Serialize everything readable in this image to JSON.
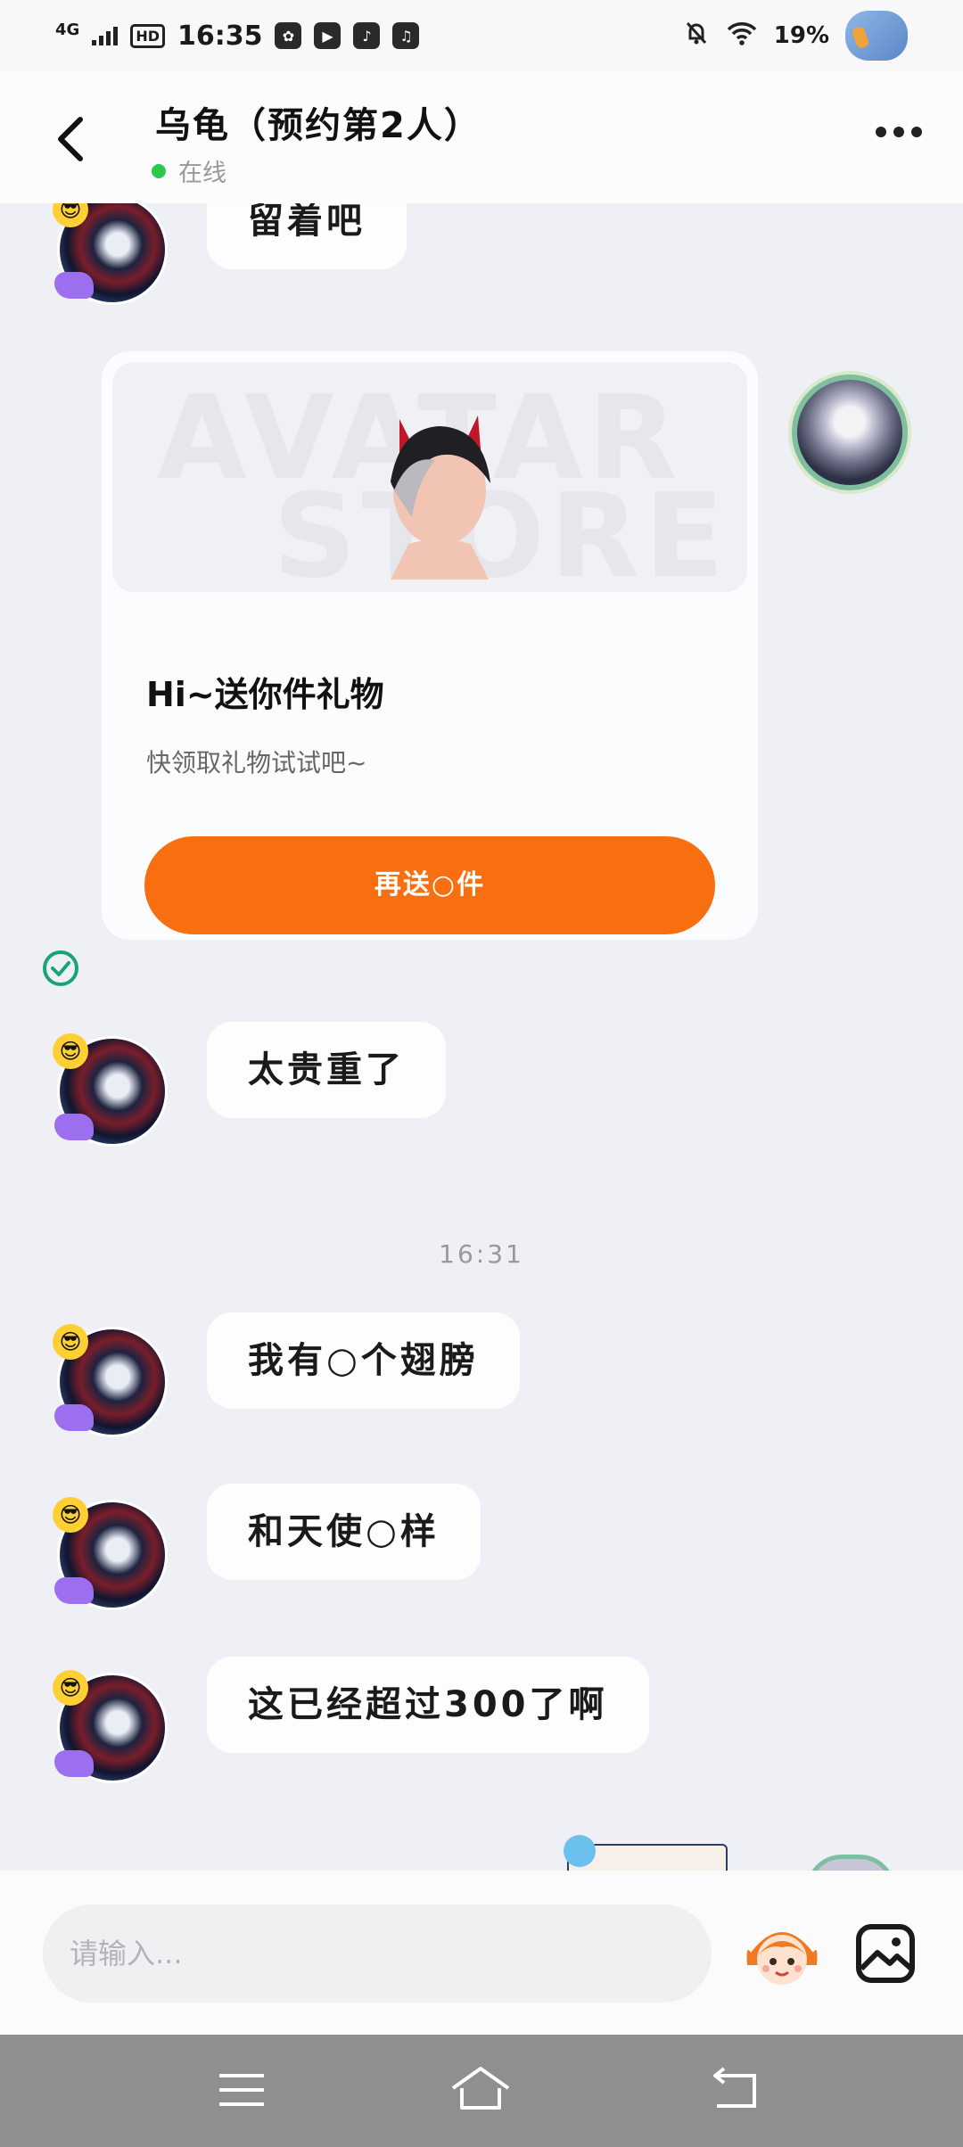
{
  "status_bar": {
    "network": "4G",
    "hd": "HD",
    "time": "16:35",
    "battery": "19%"
  },
  "header": {
    "title": "乌龟（预约第2人）",
    "status": "在线"
  },
  "messages": [
    {
      "side": "left",
      "text": "留着吧"
    },
    {
      "side": "left",
      "text": "太贵重了"
    },
    {
      "side": "left",
      "text": "我有○个翅膀"
    },
    {
      "side": "left",
      "text": "和天使○样"
    },
    {
      "side": "left",
      "text": "这已经超过300了啊"
    }
  ],
  "gift_card": {
    "watermark_line1": "AVATAR",
    "watermark_line2": "STORE",
    "title": "Hi~送你件礼物",
    "subtitle": "快领取礼物试试吧~",
    "button": "再送○件"
  },
  "timestamp": "16:31",
  "input": {
    "placeholder": "请输入..."
  },
  "colors": {
    "accent": "#f86f12",
    "online": "#2dc84d",
    "check": "#1aa37a"
  },
  "icons": [
    "back-arrow-icon",
    "more-icon",
    "check-circle-icon",
    "emoji-sticker-icon",
    "image-icon",
    "menu-icon",
    "home-icon",
    "back-nav-icon"
  ]
}
